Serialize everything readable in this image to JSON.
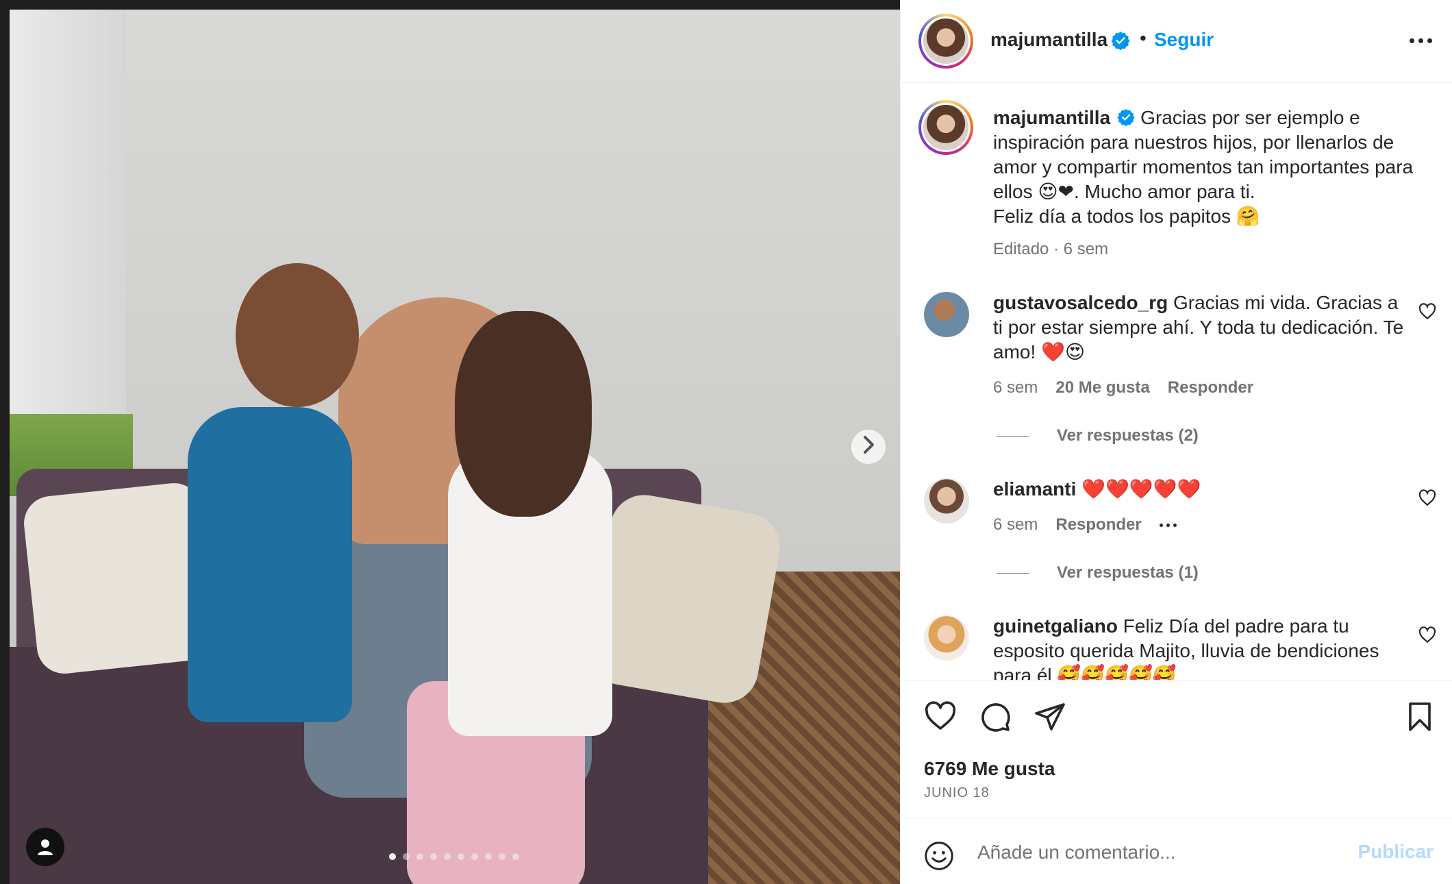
{
  "post": {
    "dots_count": 10,
    "active_dot": 0
  },
  "header": {
    "username": "majumantilla",
    "separator": "•",
    "follow_label": "Seguir"
  },
  "caption": {
    "username": "majumantilla",
    "text": "Gracias por ser ejemplo e inspiración para nuestros hijos, por llenarlos de amor y compartir momentos tan importantes para ellos 😍❤. Mucho amor para ti.",
    "text2": "Feliz día a todos los papitos 🤗",
    "meta": "Editado · 6 sem"
  },
  "comments": [
    {
      "username": "gustavosalcedo_rg",
      "text": "Gracias mi vida. Gracias a ti por estar siempre ahí. Y toda tu dedicación. Te amo! ❤️😍",
      "time": "6 sem",
      "likes": "20 Me gusta",
      "reply": "Responder",
      "replies": "Ver respuestas (2)"
    },
    {
      "username": "eliamanti",
      "text": "❤️❤️❤️❤️❤️",
      "time": "6 sem",
      "reply": "Responder",
      "replies": "Ver respuestas (1)"
    },
    {
      "username": "guinetgaliano",
      "text": "Feliz Día del padre para tu esposito querida Majito, lluvia de bendiciones para él 🥰🥰🥰🥰🥰"
    }
  ],
  "actions": {
    "likes": "6769 Me gusta",
    "date": "JUNIO 18"
  },
  "add_comment": {
    "placeholder": "Añade un comentario...",
    "publish": "Publicar"
  },
  "colors": {
    "link_blue": "#0095f6",
    "verified_blue": "#0095f6",
    "muted": "#737373",
    "publish_disabled": "#b3dbff"
  },
  "icons": [
    "next-arrow-icon",
    "user-tag-icon",
    "verified-icon",
    "more-icon",
    "heart-icon",
    "comment-icon",
    "share-icon",
    "bookmark-icon",
    "emoji-icon"
  ]
}
